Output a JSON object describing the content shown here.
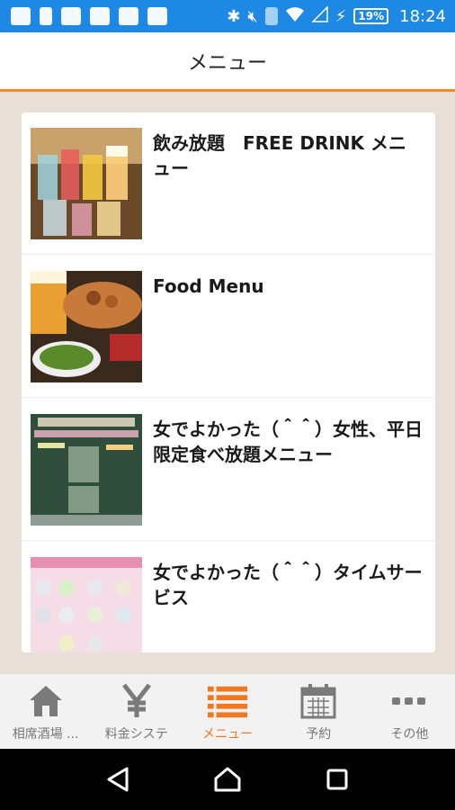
{
  "status_bar": {
    "battery": "19%",
    "time": "18:24"
  },
  "header": {
    "title": "メニュー"
  },
  "menu_items": [
    {
      "title": "飲み放題　FREE DRINK メニュー"
    },
    {
      "title": "Food Menu"
    },
    {
      "title": "女でよかった（＾＾）女性、平日限定食べ放題メニュー"
    },
    {
      "title": "女でよかった（＾＾）タイムサービス"
    }
  ],
  "bottom_nav": [
    {
      "label": "相席酒場 ...",
      "icon": "home-icon"
    },
    {
      "label": "料金システ",
      "icon": "yen-icon"
    },
    {
      "label": "メニュー",
      "icon": "list-icon",
      "active": true
    },
    {
      "label": "予約",
      "icon": "calendar-icon"
    },
    {
      "label": "その他",
      "icon": "more-icon"
    }
  ],
  "colors": {
    "status_bar": "#1e88e5",
    "accent": "#f07820",
    "background": "#e8e0d6"
  }
}
